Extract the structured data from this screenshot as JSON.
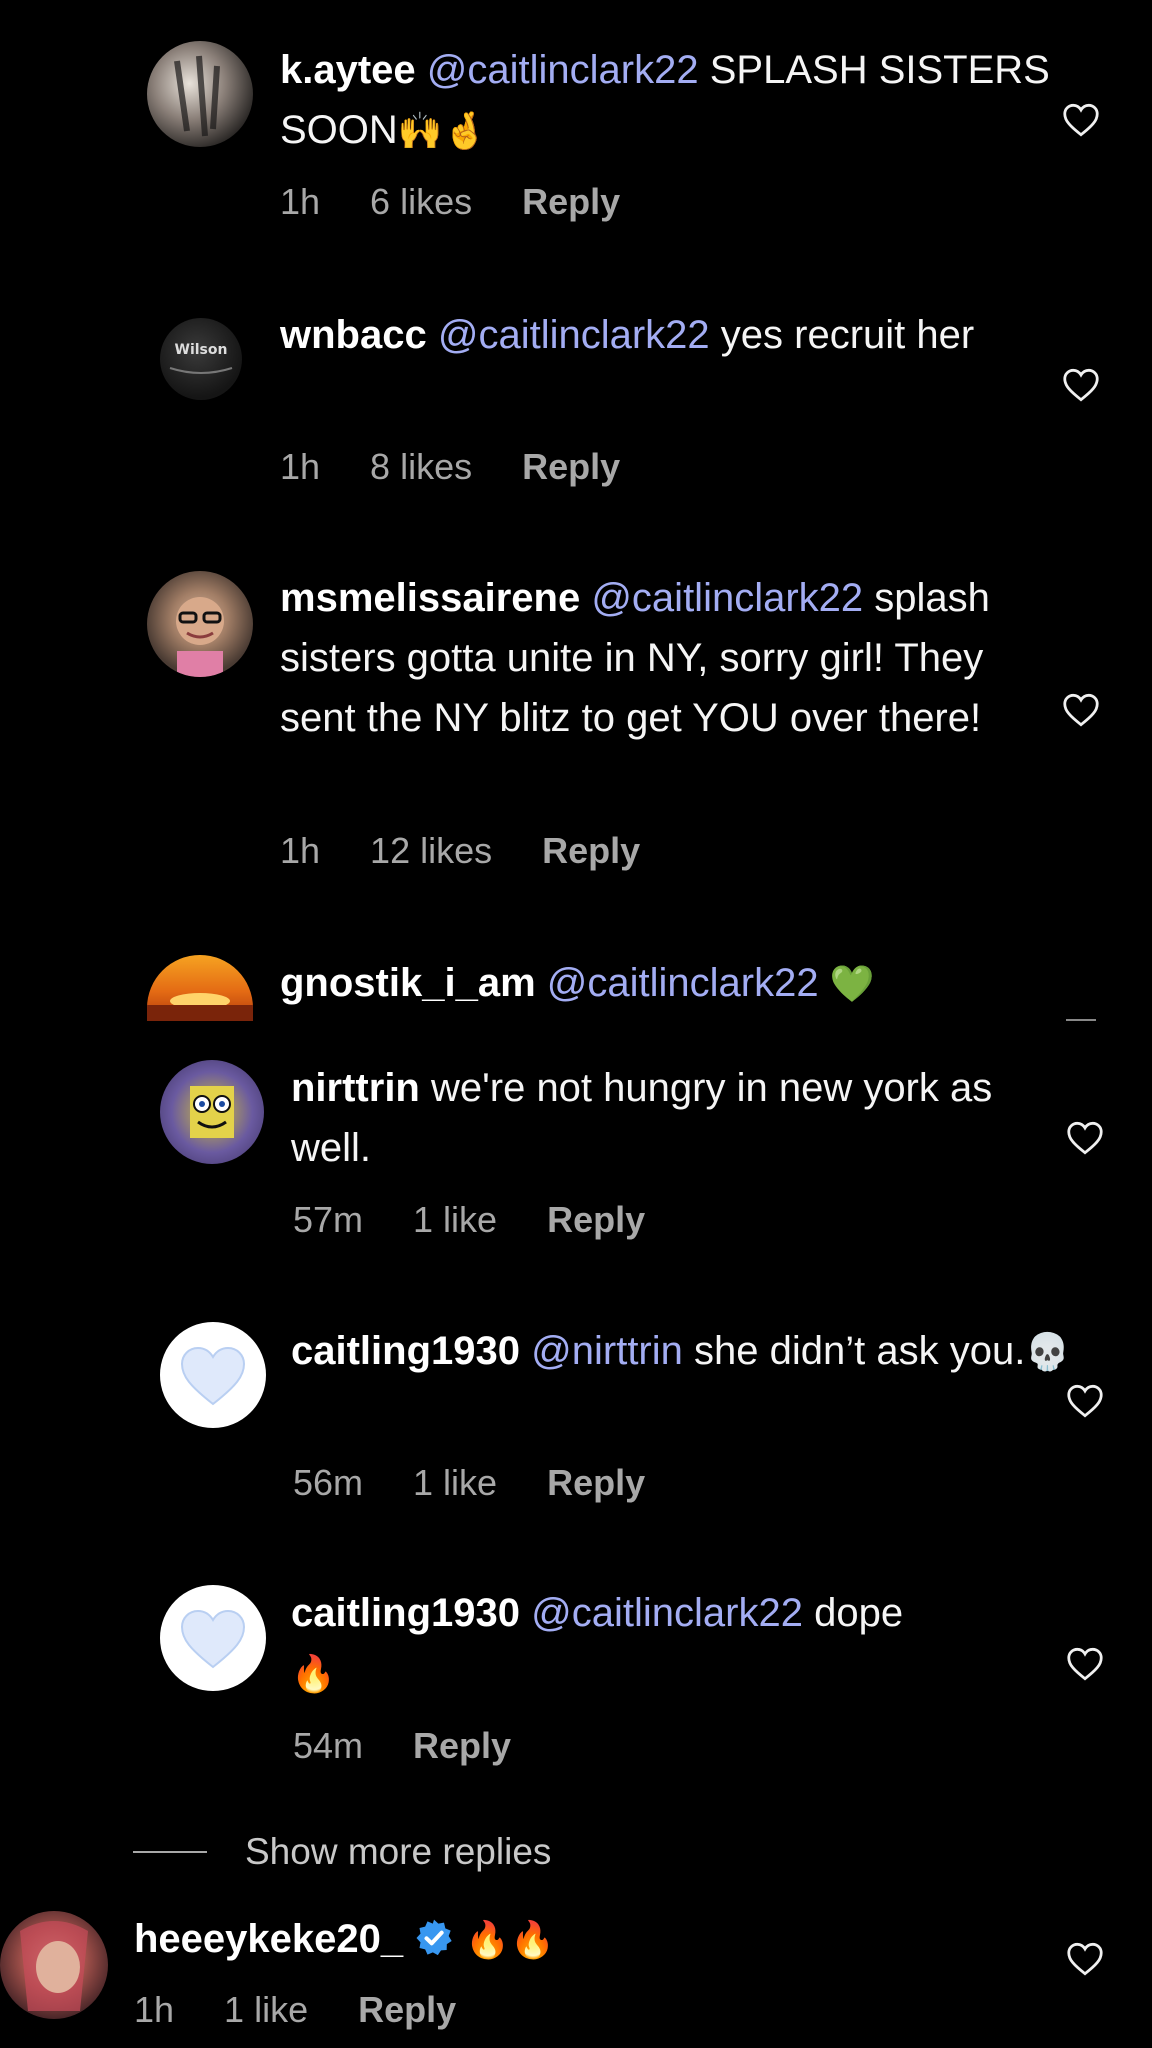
{
  "comments": [
    {
      "username": "k.aytee",
      "mention": "@caitlinclark22",
      "text": " SPLASH SISTERS SOON",
      "emoji": "🙌🤞",
      "time": "1h",
      "likes": "6 likes",
      "reply": "Reply"
    },
    {
      "username": "wnbacc",
      "mention": "@caitlinclark22",
      "text": " yes recruit her",
      "time": "1h",
      "likes": "8 likes",
      "reply": "Reply"
    },
    {
      "username": "msmelissairene",
      "mention": "@caitlinclark22",
      "text": " splash sisters gotta unite in NY, sorry girl! They sent the NY blitz to get YOU over there!",
      "time": "1h",
      "likes": "12 likes",
      "reply": "Reply"
    },
    {
      "username": "gnostik_i_am",
      "mention": "@caitlinclark22",
      "emoji": "💚"
    },
    {
      "username": "nirttrin",
      "text": " we're not hungry in new york as well.",
      "time": "57m",
      "likes": "1 like",
      "reply": "Reply"
    },
    {
      "username": "caitling1930",
      "mention": "@nirttrin",
      "text": " she didn’t ask you.",
      "emoji": "💀",
      "time": "56m",
      "likes": "1 like",
      "reply": "Reply"
    },
    {
      "username": "caitling1930",
      "mention": "@caitlinclark22",
      "text": " dope",
      "emoji": "🔥",
      "time": "54m",
      "reply": "Reply"
    },
    {
      "username": "heeeykeke20_",
      "emoji": "🔥🔥",
      "time": "1h",
      "likes": "1 like",
      "reply": "Reply"
    }
  ],
  "show_more": "Show more replies",
  "colors": {
    "background": "#000000",
    "mention": "#a3adf3",
    "meta": "#a8a8a8",
    "verified": "#3897f0"
  }
}
